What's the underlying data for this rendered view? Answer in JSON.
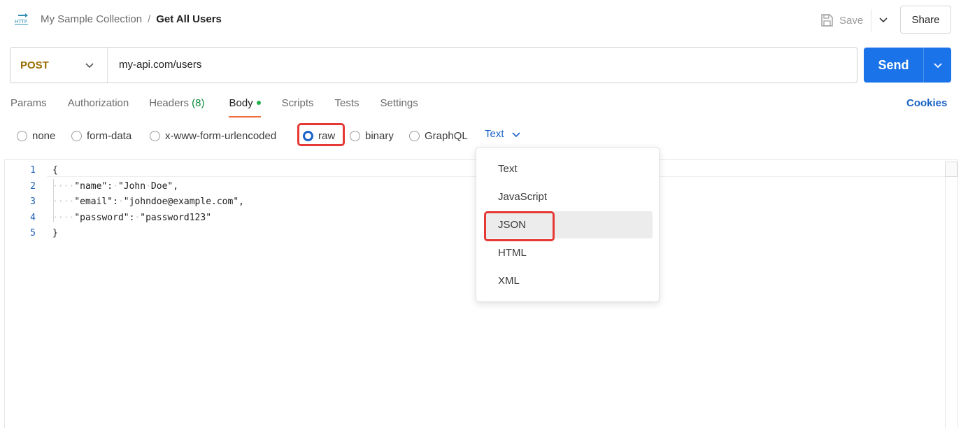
{
  "header": {
    "collection": "My Sample Collection",
    "separator": "/",
    "request_name": "Get All Users",
    "save_label": "Save",
    "share_label": "Share",
    "http_icon_text": "HTTP"
  },
  "request": {
    "method": "POST",
    "url": "my-api.com/users",
    "send_label": "Send"
  },
  "tabs": [
    {
      "label": "Params"
    },
    {
      "label": "Authorization"
    },
    {
      "label": "Headers",
      "count": "(8)"
    },
    {
      "label": "Body",
      "active": true
    },
    {
      "label": "Scripts"
    },
    {
      "label": "Tests"
    },
    {
      "label": "Settings"
    }
  ],
  "cookies_label": "Cookies",
  "body_types": [
    {
      "label": "none",
      "selected": false
    },
    {
      "label": "form-data",
      "selected": false
    },
    {
      "label": "x-www-form-urlencoded",
      "selected": false
    },
    {
      "label": "raw",
      "selected": true
    },
    {
      "label": "binary",
      "selected": false
    },
    {
      "label": "GraphQL",
      "selected": false
    }
  ],
  "language_select": {
    "value": "Text"
  },
  "editor": {
    "line_numbers": [
      "1",
      "2",
      "3",
      "4",
      "5"
    ],
    "lines": [
      "{",
      "····\"name\":·\"John·Doe\",",
      "····\"email\":·\"johndoe@example.com\",",
      "····\"password\":·\"password123\"",
      "}"
    ]
  },
  "language_dropdown": {
    "options": [
      "Text",
      "JavaScript",
      "JSON",
      "HTML",
      "XML"
    ],
    "highlighted": "JSON"
  },
  "colors": {
    "accent_blue": "#1a73e8",
    "method_post": "#9a6c00",
    "active_tab_underline": "#f26b3a",
    "highlight_box": "#e53935"
  }
}
